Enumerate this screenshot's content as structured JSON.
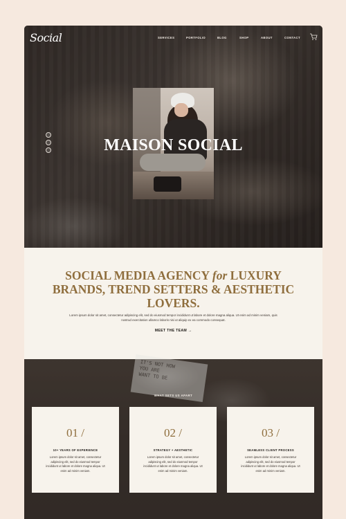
{
  "brand": {
    "logo": "Social"
  },
  "nav": {
    "items": [
      {
        "label": "SERVICES"
      },
      {
        "label": "PORTFOLIO"
      },
      {
        "label": "BLOG"
      },
      {
        "label": "SHOP"
      },
      {
        "label": "ABOUT"
      },
      {
        "label": "CONTACT"
      }
    ],
    "cart_icon": "shopping-cart-icon"
  },
  "hero": {
    "title": "MAISON SOCIAL",
    "social_icons": [
      "instagram-icon",
      "twitter-icon",
      "pinterest-icon"
    ]
  },
  "intro": {
    "heading_part1": "SOCIAL MEDIA AGENCY ",
    "heading_italic": "for",
    "heading_part2": " LUXURY BRANDS, TREND SETTERS & AESTHETIC LOVERS.",
    "body": "Lorem ipsum dolor sit amet, consectetur adipiscing elit, sed do eiusmod tempor incididunt ut labore et dolore magna aliqua. Ut enim ad minim veniam, quis nostrud exercitation ullamco laboris nisi ut aliquip ex ea commodo consequat.",
    "cta": "MEET THE TEAM →"
  },
  "features": {
    "kicker": "WHAT SETS US APART",
    "cards": [
      {
        "number": "01 /",
        "title": "10+ YEARS OF EXPERIENCE",
        "body": "Lorem ipsum dolor sit amet, consectetur adipiscing elit, sed do eiusmod tempor incididunt ut labore et dolore magna aliqua. Ut enim ad minim veniam."
      },
      {
        "number": "02 /",
        "title": "STRATEGY + AESTHETIC",
        "body": "Lorem ipsum dolor sit amet, consectetur adipiscing elit, sed do eiusmod tempor incididunt ut labore et dolore magna aliqua. Ut enim ad minim veniam."
      },
      {
        "number": "03 /",
        "title": "SEAMLESS CLIENT PROCESS",
        "body": "Lorem ipsum dolor sit amet, consectetur adipiscing elit, sed do eiusmod tempor incididunt ut labore et dolore magna aliqua. Ut enim ad minim veniam."
      }
    ]
  },
  "colors": {
    "page_background": "#f6e9df",
    "accent_gold": "#8f6e3d",
    "cream": "#f7f3ec"
  }
}
